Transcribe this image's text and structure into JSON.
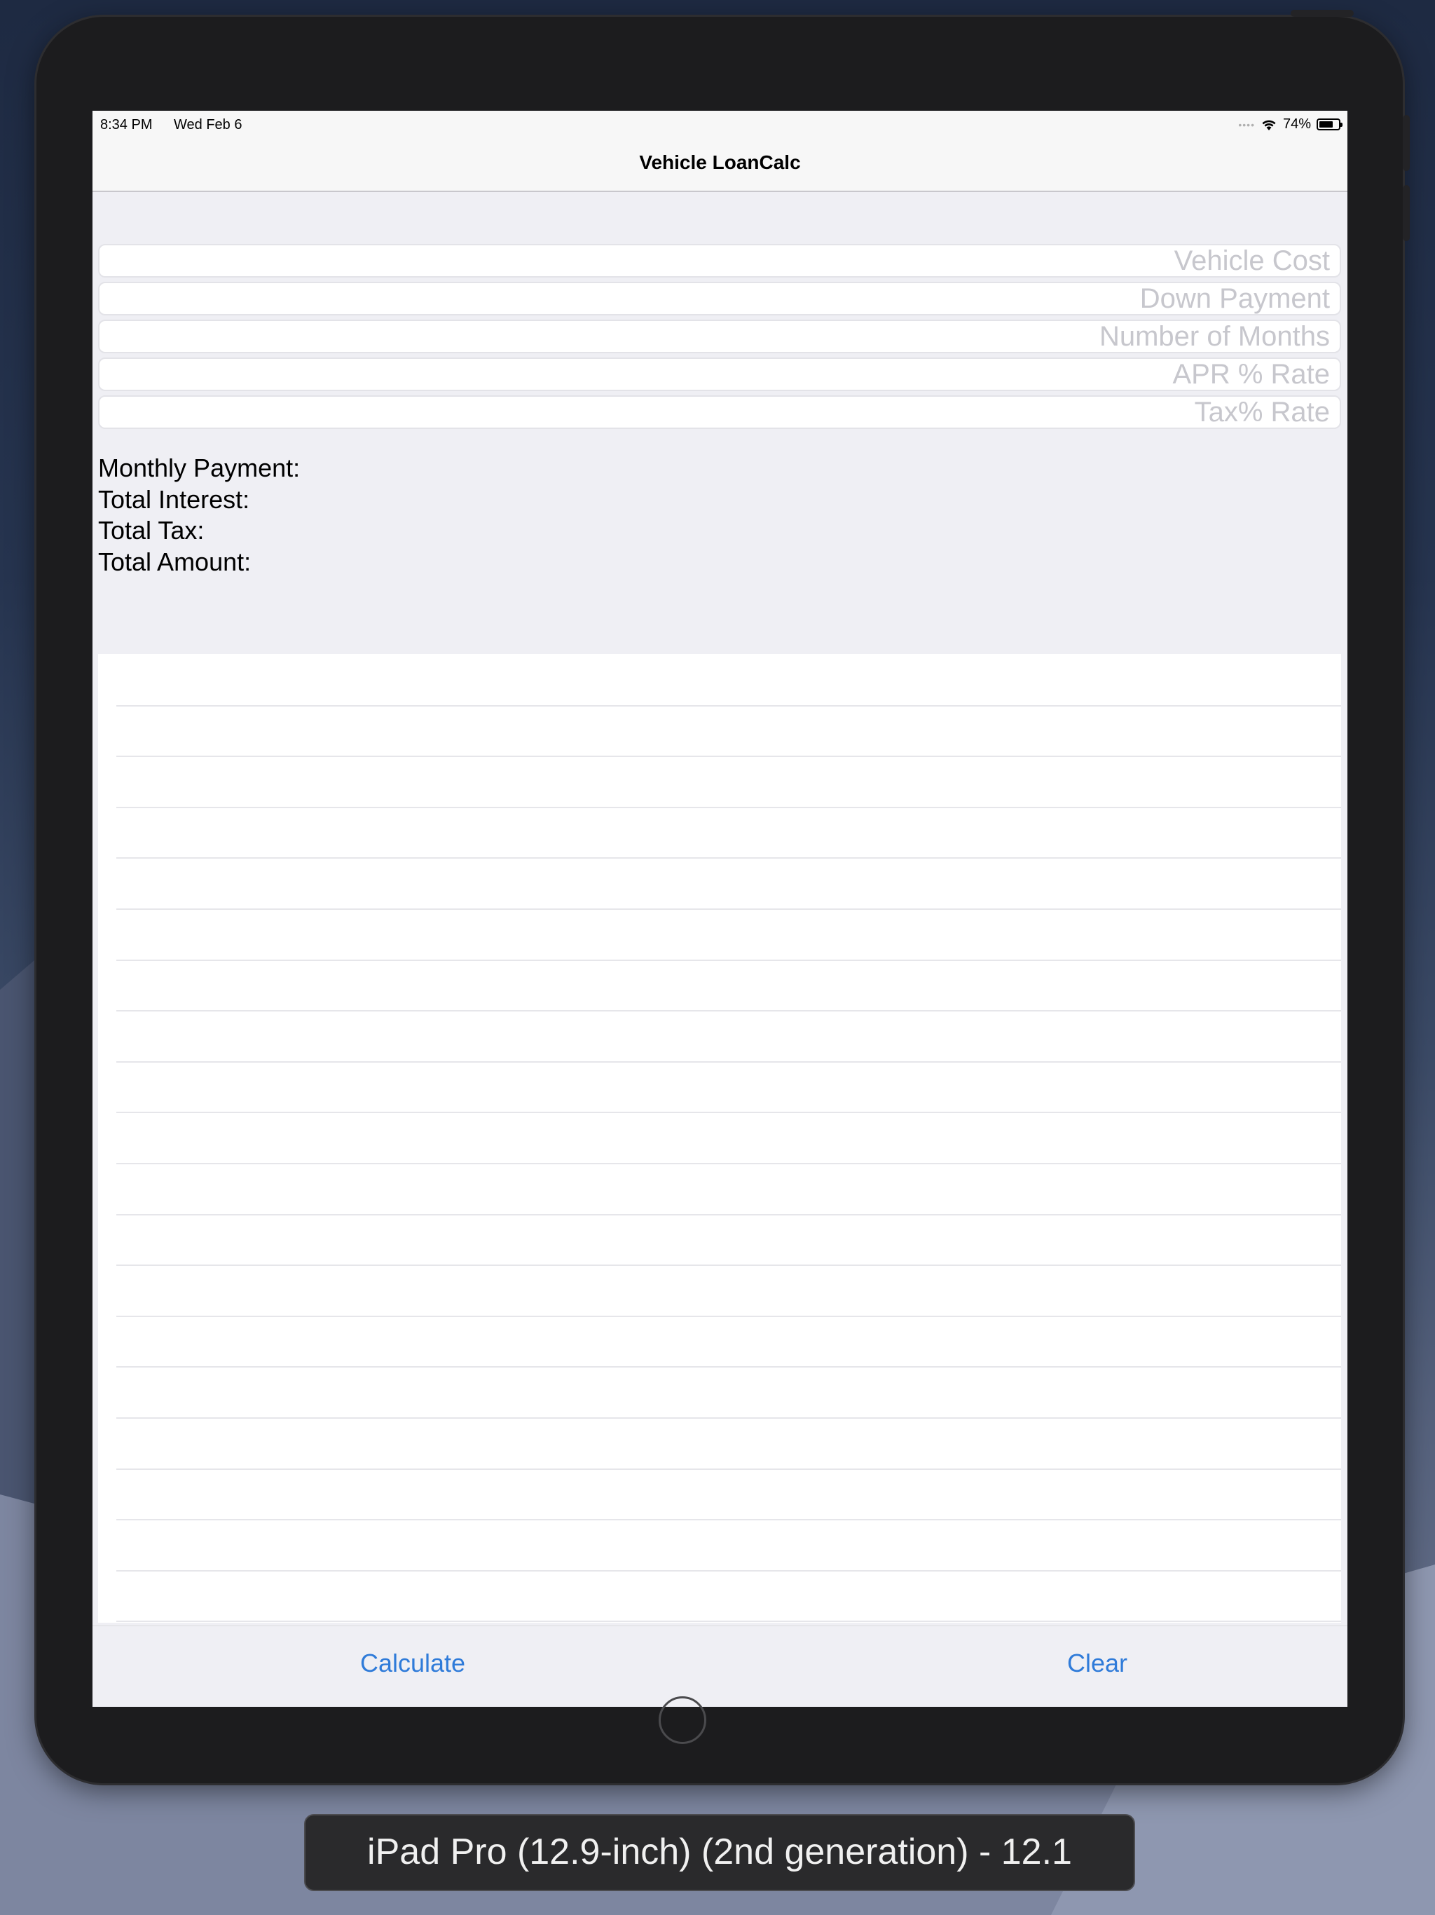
{
  "status_bar": {
    "time": "8:34 PM",
    "date": "Wed Feb 6",
    "battery_percent": "74%",
    "battery_level": 0.74,
    "icons": [
      "cellular-dots-icon",
      "wifi-icon",
      "battery-icon"
    ]
  },
  "nav": {
    "title": "Vehicle LoanCalc"
  },
  "form": {
    "fields": [
      {
        "placeholder": "Vehicle Cost",
        "value": ""
      },
      {
        "placeholder": "Down Payment",
        "value": ""
      },
      {
        "placeholder": "Number of Months",
        "value": ""
      },
      {
        "placeholder": "APR % Rate",
        "value": ""
      },
      {
        "placeholder": "Tax% Rate",
        "value": ""
      }
    ]
  },
  "results": {
    "monthly_payment_label": "Monthly Payment:",
    "total_interest_label": "Total Interest:",
    "total_tax_label": "Total Tax:",
    "total_amount_label": "Total Amount:"
  },
  "toolbar": {
    "calculate_label": "Calculate",
    "clear_label": "Clear"
  },
  "simulator": {
    "device_label": "iPad Pro (12.9-inch) (2nd generation) - 12.1"
  },
  "colors": {
    "accent": "#2f7bd9",
    "placeholder": "#c7c7cd",
    "background": "#efeff4"
  }
}
